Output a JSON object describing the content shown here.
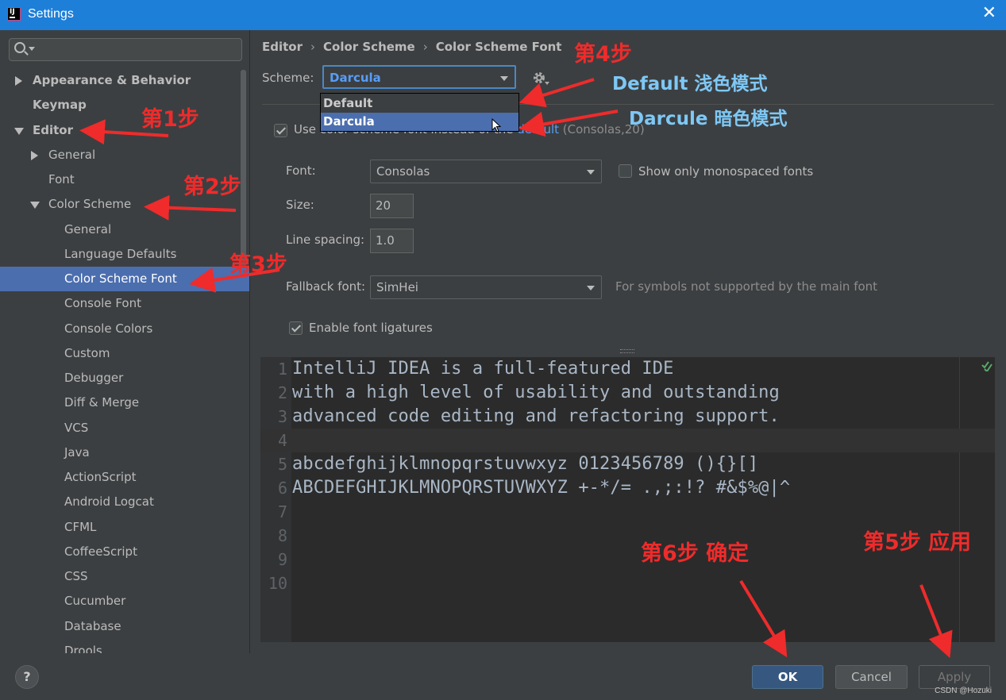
{
  "window": {
    "title": "Settings",
    "close_glyph": "✕"
  },
  "sidebar": {
    "search_placeholder": "",
    "items": [
      {
        "label": "Appearance & Behavior"
      },
      {
        "label": "Keymap"
      },
      {
        "label": "Editor"
      },
      {
        "label": "General"
      },
      {
        "label": "Font"
      },
      {
        "label": "Color Scheme"
      },
      {
        "label": "General"
      },
      {
        "label": "Language Defaults"
      },
      {
        "label": "Color Scheme Font"
      },
      {
        "label": "Console Font"
      },
      {
        "label": "Console Colors"
      },
      {
        "label": "Custom"
      },
      {
        "label": "Debugger"
      },
      {
        "label": "Diff & Merge"
      },
      {
        "label": "VCS"
      },
      {
        "label": "Java"
      },
      {
        "label": "ActionScript"
      },
      {
        "label": "Android Logcat"
      },
      {
        "label": "CFML"
      },
      {
        "label": "CoffeeScript"
      },
      {
        "label": "CSS"
      },
      {
        "label": "Cucumber"
      },
      {
        "label": "Database"
      },
      {
        "label": "Drools"
      }
    ]
  },
  "breadcrumb": [
    "Editor",
    "Color Scheme",
    "Color Scheme Font"
  ],
  "breadcrumb_sep": "›",
  "scheme": {
    "label": "Scheme:",
    "value": "Darcula",
    "options": [
      "Default",
      "Darcula"
    ]
  },
  "use_scheme_font": {
    "text_visible": "Use color scheme font instead of the",
    "link": "default",
    "suffix": "(Consolas,20)"
  },
  "font": {
    "label": "Font:",
    "value": "Consolas"
  },
  "monospaced": {
    "label": "Show only monospaced fonts"
  },
  "size": {
    "label": "Size:",
    "value": "20"
  },
  "line_spacing": {
    "label": "Line spacing:",
    "value": "1.0"
  },
  "fallback": {
    "label": "Fallback font:",
    "value": "SimHei",
    "hint": "For symbols not supported by the main font"
  },
  "ligatures": {
    "label": "Enable font ligatures"
  },
  "editor": {
    "lines": [
      {
        "num": "1",
        "code": "IntelliJ IDEA is a full-featured IDE"
      },
      {
        "num": "2",
        "code": "with a high level of usability and outstanding"
      },
      {
        "num": "3",
        "code": "advanced code editing and refactoring support."
      },
      {
        "num": "4",
        "code": ""
      },
      {
        "num": "5",
        "code": "abcdefghijklmnopqrstuvwxyz 0123456789 (){}[]"
      },
      {
        "num": "6",
        "code": "ABCDEFGHIJKLMNOPQRSTUVWXYZ +-*/= .,;:!? #&$%@|^"
      },
      {
        "num": "7",
        "code": ""
      },
      {
        "num": "8",
        "code": ""
      },
      {
        "num": "9",
        "code": ""
      },
      {
        "num": "10",
        "code": ""
      }
    ]
  },
  "buttons": {
    "help": "?",
    "ok": "OK",
    "cancel": "Cancel",
    "apply": "Apply"
  },
  "annotations": {
    "step1": "第1步",
    "step2": "第2步",
    "step3": "第3步",
    "step4": "第4步",
    "step5": "第5步  应用",
    "step6": "第6步  确定",
    "default_note": "Default  浅色模式",
    "darcula_note": "Darcule  暗色模式"
  },
  "watermark": "CSDN @Hozuki",
  "colors": {
    "accent": "#4b6eaf",
    "title_bar": "#1e7fd8",
    "annotation_red": "#ef2b2b",
    "annotation_blue": "#7ec8f5"
  }
}
